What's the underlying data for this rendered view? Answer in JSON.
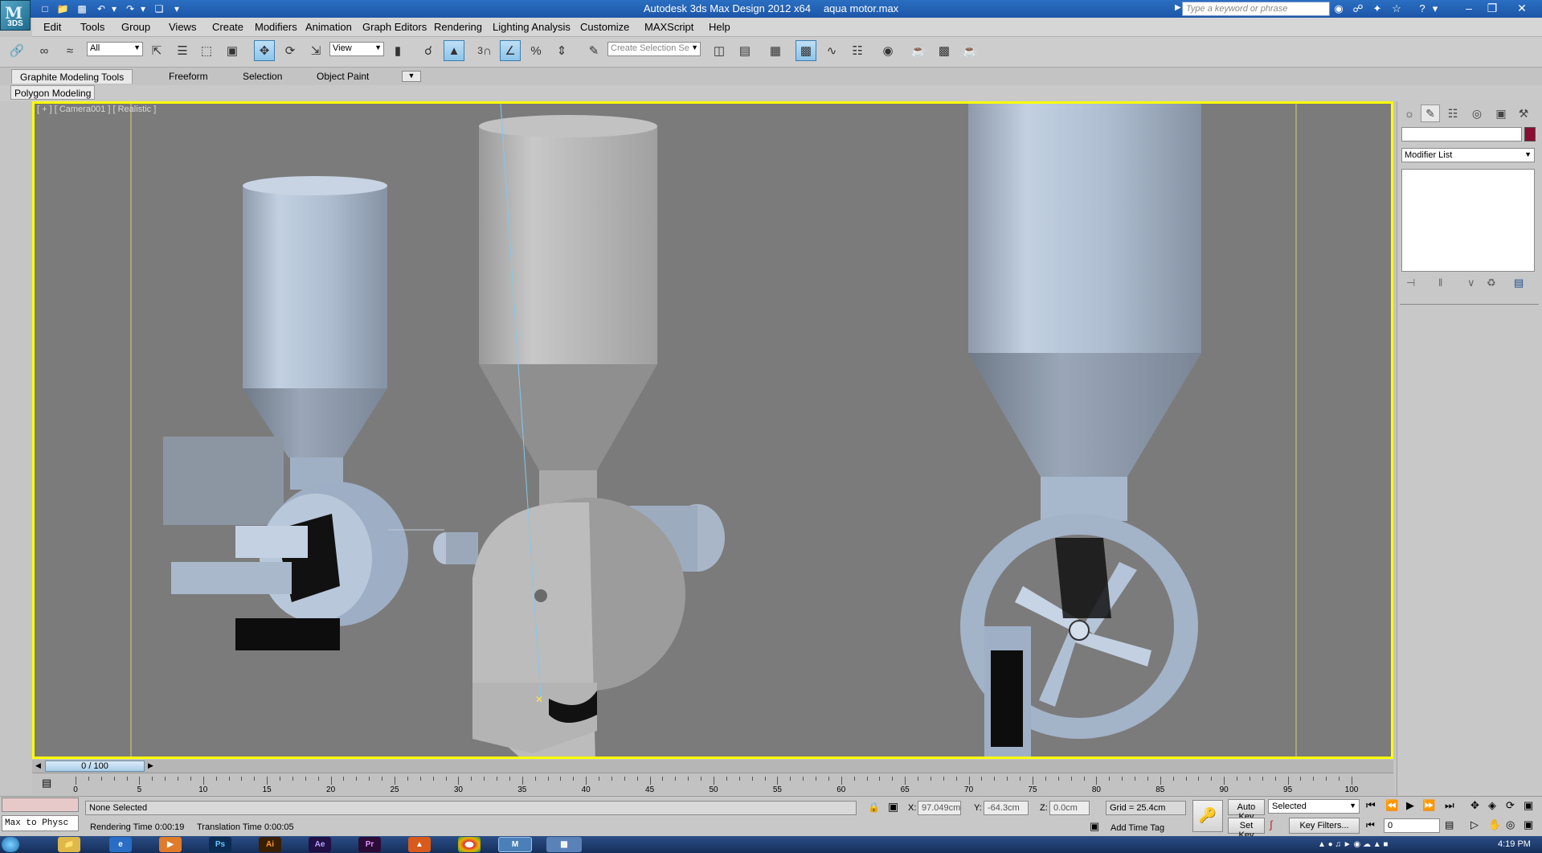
{
  "window": {
    "app_title": "Autodesk 3ds Max Design 2012 x64",
    "file_name": "aqua motor.max",
    "logo_text": "3DS",
    "search_placeholder": "Type a keyword or phrase"
  },
  "menu": [
    "Edit",
    "Tools",
    "Group",
    "Views",
    "Create",
    "Modifiers",
    "Animation",
    "Graph Editors",
    "Rendering",
    "Lighting Analysis",
    "Customize",
    "MAXScript",
    "Help"
  ],
  "toolbar": {
    "selection_filter": "All",
    "ref_coord": "View",
    "snap_label": "3",
    "selection_set_placeholder": "Create Selection Se"
  },
  "ribbon": {
    "tabs": [
      "Graphite Modeling Tools",
      "Freeform",
      "Selection",
      "Object Paint"
    ],
    "active_tab": "Graphite Modeling Tools",
    "panel_label": "Polygon Modeling"
  },
  "viewport": {
    "label": "[ + ] [ Camera001 ] [ Realistic ]",
    "border_color": "#ffff00",
    "background": "#7b7b7b"
  },
  "command_panel": {
    "modifier_list": "Modifier List",
    "object_color": "#8a0d33"
  },
  "timeline": {
    "frame_display": "0 / 100",
    "ticks": [
      "0",
      "5",
      "10",
      "15",
      "20",
      "25",
      "30",
      "35",
      "40",
      "45",
      "50",
      "55",
      "60",
      "65",
      "70",
      "75",
      "80",
      "85",
      "90",
      "95",
      "100"
    ]
  },
  "status": {
    "selection": "None Selected",
    "rendering_time": "Rendering Time  0:00:19",
    "translation_time": "Translation Time  0:00:05",
    "x_label": "X:",
    "x_value": "97.049cm",
    "y_label": "Y:",
    "y_value": "-64.3cm",
    "z_label": "Z:",
    "z_value": "0.0cm",
    "grid": "Grid = 25.4cm",
    "add_time_tag": "Add Time Tag",
    "auto_key": "Auto Key",
    "set_key": "Set Key",
    "key_mode": "Selected",
    "key_filters": "Key Filters...",
    "current_frame": "0",
    "maxscript_prompt": "Max to Physc"
  },
  "taskbar": {
    "clock": "4:19 PM",
    "apps": [
      "Ps",
      "Ai",
      "Ae",
      "Pr"
    ]
  }
}
